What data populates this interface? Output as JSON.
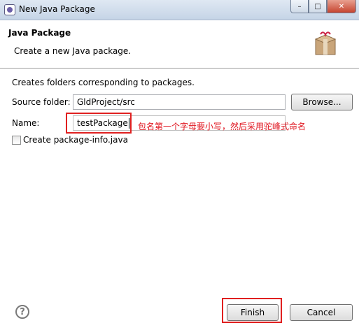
{
  "window": {
    "title": "New Java Package",
    "minimize": "–",
    "maximize": "□",
    "close": "✕",
    "icon": "eclipse-app-icon"
  },
  "header": {
    "title": "Java Package",
    "description": "Create a new Java package.",
    "icon": "package-icon"
  },
  "form": {
    "intro": "Creates folders corresponding to packages.",
    "source_folder_label": "Source folder:",
    "source_folder_value": "GldProject/src",
    "browse_label": "Browse...",
    "name_label": "Name:",
    "name_value": "testPackage",
    "annotation": "包名第一个字母要小写，然后采用驼峰式命名",
    "create_info_label": "Create package-info.java",
    "create_info_checked": false
  },
  "footer": {
    "help_icon": "?",
    "finish_label": "Finish",
    "cancel_label": "Cancel"
  },
  "colors": {
    "highlight": "#e02020",
    "annotation": "#e0141e"
  }
}
